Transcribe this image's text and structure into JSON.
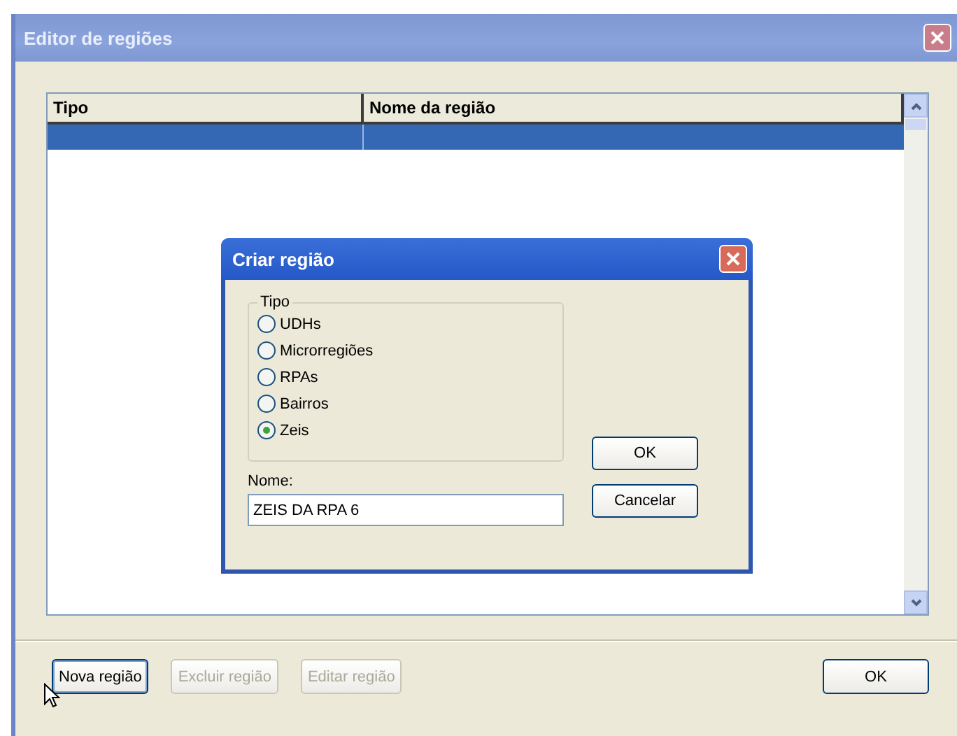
{
  "window": {
    "title": "Editor de regiões"
  },
  "table": {
    "columns": [
      "Tipo",
      "Nome da região"
    ],
    "rows": [
      {
        "selected": true
      }
    ]
  },
  "dialog": {
    "title": "Criar região",
    "group_label": "Tipo",
    "options": [
      {
        "label": "UDHs",
        "selected": false
      },
      {
        "label": "Microrregiões",
        "selected": false
      },
      {
        "label": "RPAs",
        "selected": false
      },
      {
        "label": "Bairros",
        "selected": false
      },
      {
        "label": "Zeis",
        "selected": true
      }
    ],
    "name_label": "Nome:",
    "name_value": "ZEIS DA RPA 6",
    "buttons": [
      "OK",
      "Cancelar"
    ]
  },
  "buttons": [
    {
      "label": "Nova região",
      "disabled": false
    },
    {
      "label": "Excluir região",
      "disabled": true
    },
    {
      "label": "Editar região",
      "disabled": true
    }
  ],
  "ok_button": "OK"
}
